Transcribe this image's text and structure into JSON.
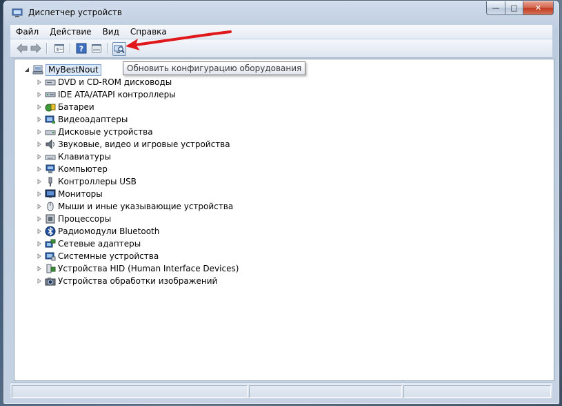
{
  "window": {
    "title": "Диспетчер устройств",
    "caption_buttons": {
      "minimize": "—",
      "maximize": "□",
      "close": "✕"
    }
  },
  "menu": [
    "Файл",
    "Действие",
    "Вид",
    "Справка"
  ],
  "toolbar": {
    "buttons": [
      "back-icon",
      "forward-icon",
      "properties-icon",
      "help-icon",
      "details-icon",
      "scan-hardware-icon"
    ]
  },
  "tooltip": "Обновить конфигурацию оборудования",
  "tree": {
    "root": "MyBestNout",
    "categories": [
      {
        "label": "DVD и CD-ROM дисководы",
        "icon": "dvd-drive-icon"
      },
      {
        "label": "IDE ATA/ATAPI контроллеры",
        "icon": "ide-controller-icon"
      },
      {
        "label": "Батареи",
        "icon": "battery-icon"
      },
      {
        "label": "Видеоадаптеры",
        "icon": "display-adapter-icon"
      },
      {
        "label": "Дисковые устройства",
        "icon": "disk-drive-icon"
      },
      {
        "label": "Звуковые, видео и игровые устройства",
        "icon": "sound-icon"
      },
      {
        "label": "Клавиатуры",
        "icon": "keyboard-icon"
      },
      {
        "label": "Компьютер",
        "icon": "computer-icon"
      },
      {
        "label": "Контроллеры USB",
        "icon": "usb-icon"
      },
      {
        "label": "Мониторы",
        "icon": "monitor-icon"
      },
      {
        "label": "Мыши и иные указывающие устройства",
        "icon": "mouse-icon"
      },
      {
        "label": "Процессоры",
        "icon": "processor-icon"
      },
      {
        "label": "Радиомодули Bluetooth",
        "icon": "bluetooth-icon"
      },
      {
        "label": "Сетевые адаптеры",
        "icon": "network-adapter-icon"
      },
      {
        "label": "Системные устройства",
        "icon": "system-device-icon"
      },
      {
        "label": "Устройства HID (Human Interface Devices)",
        "icon": "hid-icon"
      },
      {
        "label": "Устройства обработки изображений",
        "icon": "imaging-device-icon"
      }
    ]
  },
  "annotation": {
    "color": "#e0181b",
    "points_to": "scan-hardware-icon"
  }
}
